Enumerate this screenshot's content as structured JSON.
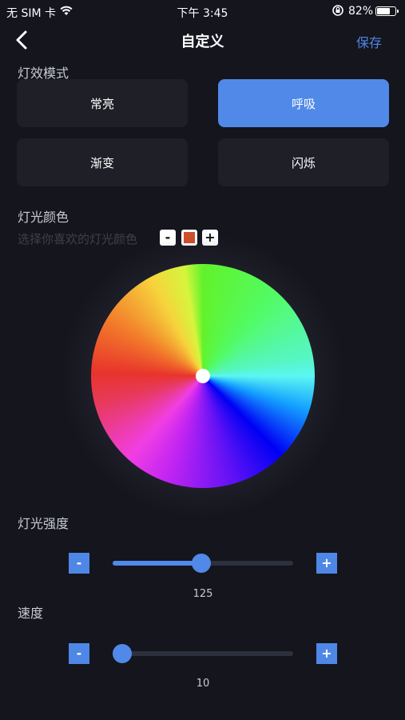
{
  "status_bar": {
    "carrier": "无 SIM 卡",
    "time": "下午 3:45",
    "battery": "82%",
    "battery_level": 0.82
  },
  "header": {
    "title": "自定义",
    "save_label": "保存",
    "back_icon": "chevron-left-icon"
  },
  "modes": {
    "label": "灯效模式",
    "options": [
      "常亮",
      "呼吸",
      "渐变",
      "闪烁"
    ],
    "selected": "呼吸",
    "accent": "#5189e8"
  },
  "color": {
    "label": "灯光颜色",
    "hint": "选择你喜欢的灯光颜色",
    "minus": "-",
    "plus": "+",
    "current_color": "#d04f2a"
  },
  "brightness": {
    "label": "灯光强度",
    "value": "125",
    "min": 0,
    "max": 255,
    "minus": "-",
    "plus": "+"
  },
  "speed": {
    "label": "速度",
    "value": "10",
    "min": 10,
    "max": 100,
    "minus": "-",
    "plus": "+"
  }
}
